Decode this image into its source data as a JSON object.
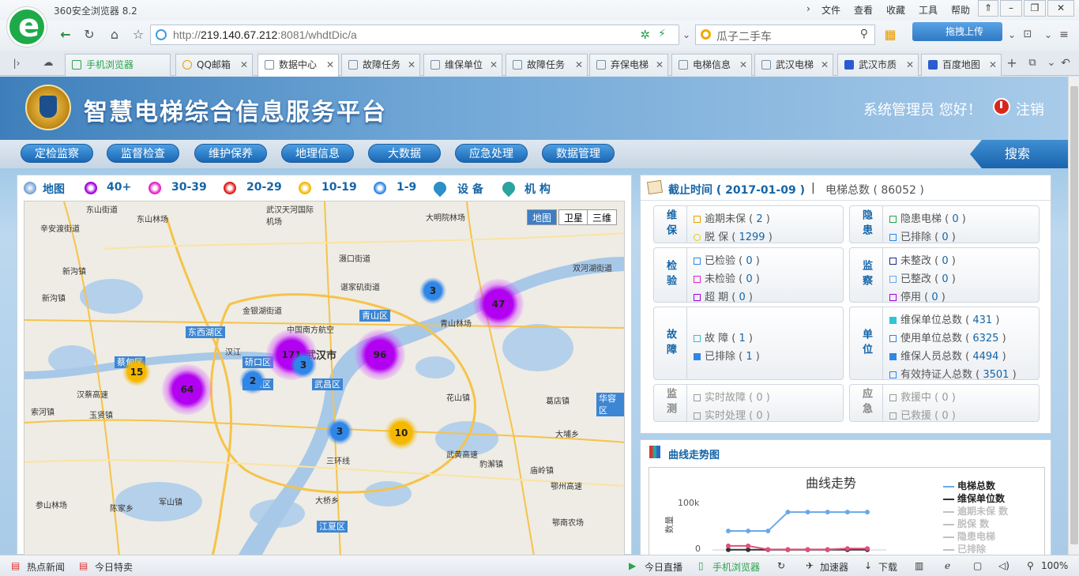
{
  "browser": {
    "title": "360安全浏览器 8.2",
    "menu": [
      "文件",
      "查看",
      "收藏",
      "工具",
      "帮助"
    ],
    "url_prefix": "http://",
    "url_host": "219.140.67.212",
    "url_rest": ":8081/whdtDic/a",
    "search_text": "瓜子二手车",
    "upload_label": "拖拽上传",
    "tabs": [
      {
        "label": "手机浏览器"
      },
      {
        "label": "QQ邮箱"
      },
      {
        "label": "数据中心"
      },
      {
        "label": "故障任务"
      },
      {
        "label": "维保单位"
      },
      {
        "label": "故障任务"
      },
      {
        "label": "弃保电梯"
      },
      {
        "label": "电梯信息"
      },
      {
        "label": "武汉电梯"
      },
      {
        "label": "武汉市质"
      },
      {
        "label": "百度地图"
      }
    ],
    "status": {
      "news": "热点新闻",
      "deals": "今日特卖",
      "live": "今日直播",
      "mobile": "手机浏览器",
      "accelerator": "加速器",
      "download": "下载",
      "zoom": "100%"
    }
  },
  "site": {
    "title": "智慧电梯综合信息服务平台",
    "greeting": "系统管理员 您好！",
    "logout": "注销",
    "nav": [
      "定检监察",
      "监督检查",
      "维护保养",
      "地理信息",
      "大数据",
      "应急处理",
      "数据管理"
    ],
    "search": "搜索"
  },
  "map": {
    "legend": {
      "map": "地图",
      "l40": "40+",
      "l30": "30-39",
      "l20": "20-29",
      "l10": "10-19",
      "l1": "1-9",
      "device": "设 备",
      "org": "机 构"
    },
    "legend_colors": {
      "l40": "#a100e0",
      "l30": "#e620c8",
      "l20": "#e21a1a",
      "l10": "#f5b800",
      "l1": "#2f86e8"
    },
    "tabs": [
      "地图",
      "卫星",
      "三维"
    ],
    "clusters": [
      {
        "count": "171"
      },
      {
        "count": "96"
      },
      {
        "count": "64"
      },
      {
        "count": "47"
      },
      {
        "count": "15"
      },
      {
        "count": "10"
      },
      {
        "count": "3"
      },
      {
        "count": "3"
      },
      {
        "count": "3"
      },
      {
        "count": "2"
      }
    ],
    "place_labels": [
      "东山街道",
      "东山林场",
      "武汉天河国际机场",
      "大明院林场",
      "辛安渡街道",
      "新沟镇",
      "新沟镇",
      "金银湖街道",
      "谌家矶街道",
      "中国南方航空",
      "武汉市",
      "青山林场",
      "东西湖区",
      "青山区",
      "硚口区",
      "武昌区",
      "汉阳区",
      "蔡甸区",
      "花山镇",
      "葛店镇",
      "华容区",
      "汉蔡高速",
      "索河镇",
      "玉贤镇",
      "汉江",
      "大埔乡",
      "武黄高速",
      "豹澥镇",
      "庙岭镇",
      "鄂州高速",
      "三环线",
      "大桥乡",
      "江夏区",
      "鄂南农场",
      "陈家乡",
      "军山镇",
      "参山林场",
      "双河湖街道",
      "滠口街道"
    ]
  },
  "info": {
    "cutoff": "截止时间 ( 2017-01-09 )",
    "sep": "|",
    "total": "电梯总数 ( 86052 )",
    "groups": [
      {
        "cat": "维保",
        "rows": [
          {
            "label": "逾期未保",
            "value": "2"
          },
          {
            "label": "脱 保",
            "value": "1299"
          }
        ]
      },
      {
        "cat": "隐患",
        "rows": [
          {
            "label": "隐患电梯",
            "value": "0"
          },
          {
            "label": "已排除",
            "value": "0"
          }
        ]
      },
      {
        "cat": "检验",
        "rows": [
          {
            "label": "已检验",
            "value": "0"
          },
          {
            "label": "未检验",
            "value": "0"
          },
          {
            "label": "超 期",
            "value": "0"
          }
        ]
      },
      {
        "cat": "监察",
        "rows": [
          {
            "label": "未整改",
            "value": "0"
          },
          {
            "label": "已整改",
            "value": "0"
          },
          {
            "label": "停用",
            "value": "0"
          }
        ]
      },
      {
        "cat": "故障",
        "rows": [
          {
            "label": "故 障",
            "value": "1"
          },
          {
            "label": "已排除",
            "value": "1"
          }
        ]
      },
      {
        "cat": "单位",
        "rows": [
          {
            "label": "维保单位总数",
            "value": "431"
          },
          {
            "label": "使用单位总数",
            "value": "6325"
          },
          {
            "label": "维保人员总数",
            "value": "4494"
          },
          {
            "label": "有效持证人总数",
            "value": "3501"
          }
        ]
      },
      {
        "cat": "监测",
        "rows": [
          {
            "label": "实时故障",
            "value": "0"
          },
          {
            "label": "实时处理",
            "value": "0"
          }
        ]
      },
      {
        "cat": "应急",
        "rows": [
          {
            "label": "救援中",
            "value": "0"
          },
          {
            "label": "已救援",
            "value": "0"
          }
        ]
      }
    ]
  },
  "trend": {
    "panel_title": "曲线走势图",
    "chart_data": {
      "type": "line",
      "title": "曲线走势",
      "ylabel": "数量",
      "yticks": [
        "100k",
        "0"
      ],
      "ylim": [
        0,
        100000
      ],
      "series": [
        {
          "name": "电梯总数",
          "color": "#6aa9e8",
          "values": [
            42000,
            42000,
            42000,
            84000,
            84000,
            84000,
            84000,
            84000
          ]
        },
        {
          "name": "维保单位数",
          "color": "#333333",
          "values": [
            400,
            420,
            420,
            430,
            430,
            431,
            431,
            431
          ]
        },
        {
          "name": "逾期未保 数",
          "color": "#e0507a",
          "values": [
            9000,
            9000,
            1000,
            1000,
            1000,
            1000,
            3000,
            3000
          ]
        },
        {
          "name": "脱保 数",
          "color": "#c0c0c0",
          "values": []
        },
        {
          "name": "隐患电梯",
          "color": "#c0c0c0",
          "values": []
        },
        {
          "name": "已排除",
          "color": "#c0c0c0",
          "values": []
        }
      ]
    }
  }
}
